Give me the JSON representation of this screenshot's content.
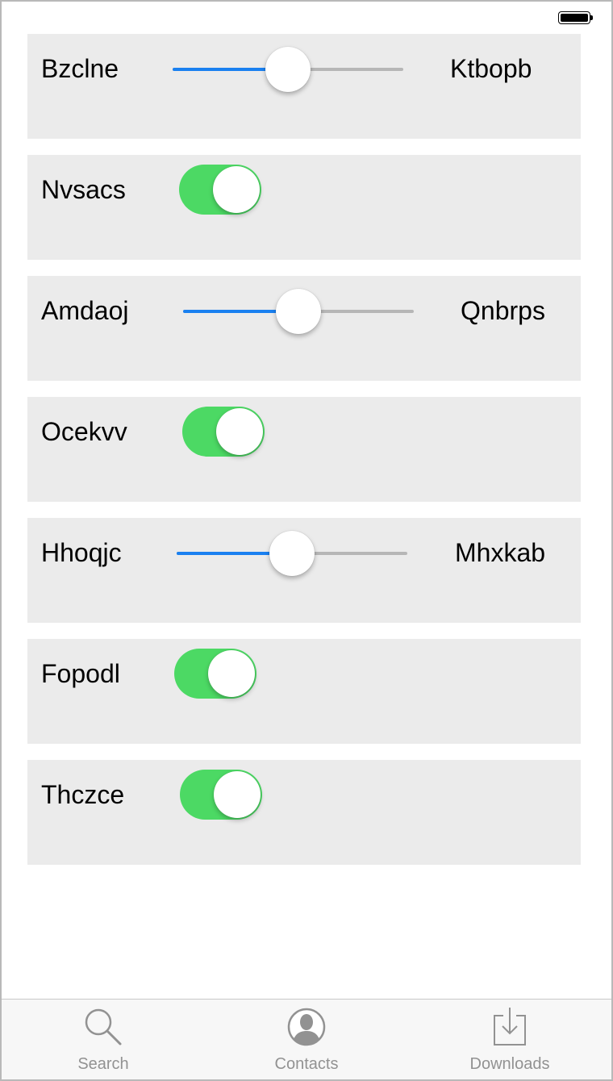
{
  "colors": {
    "accent": "#1a80f0",
    "toggle_on": "#4cd964",
    "row_bg": "#ebebeb",
    "tab_inactive": "#929292"
  },
  "rows": [
    {
      "kind": "slider",
      "label": "Bzclne",
      "right_label": "Ktbopb",
      "value": 0.5
    },
    {
      "kind": "toggle",
      "label": "Nvsacs",
      "on": true
    },
    {
      "kind": "slider",
      "label": "Amdaoj",
      "right_label": "Qnbrps",
      "value": 0.5
    },
    {
      "kind": "toggle",
      "label": "Ocekvv",
      "on": true
    },
    {
      "kind": "slider",
      "label": "Hhoqjc",
      "right_label": "Mhxkab",
      "value": 0.5
    },
    {
      "kind": "toggle",
      "label": "Fopodl",
      "on": true
    },
    {
      "kind": "toggle",
      "label": "Thczce",
      "on": true
    }
  ],
  "tabbar": {
    "tabs": [
      {
        "label": "Search",
        "icon": "search-icon"
      },
      {
        "label": "Contacts",
        "icon": "contacts-icon"
      },
      {
        "label": "Downloads",
        "icon": "downloads-icon"
      }
    ]
  },
  "status_bar": {
    "battery_level": 1.0
  }
}
